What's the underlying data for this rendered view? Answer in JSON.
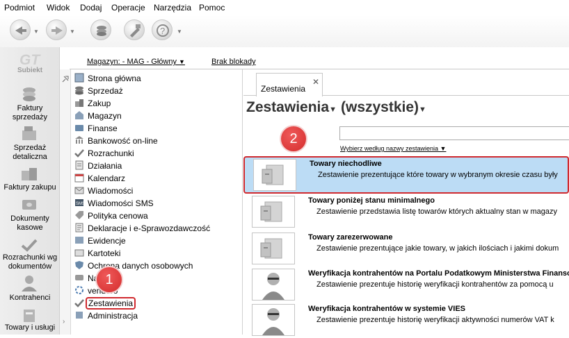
{
  "menu": [
    "Podmiot",
    "Widok",
    "Dodaj",
    "Operacje",
    "Narzędzia",
    "Pomoc"
  ],
  "app_logo": "Subiekt",
  "leftbar": [
    {
      "label": "Faktury sprzedaży",
      "icon": "coins-icon"
    },
    {
      "label": "Sprzedaż detaliczna",
      "icon": "cash-register-icon"
    },
    {
      "label": "Faktury zakupu",
      "icon": "boxes-icon"
    },
    {
      "label": "Dokumenty kasowe",
      "icon": "cash-documents-icon"
    },
    {
      "label": "Rozrachunki wg dokumentów",
      "icon": "settlements-icon"
    },
    {
      "label": "Kontrahenci",
      "icon": "person-icon"
    },
    {
      "label": "Towary i usługi",
      "icon": "goods-icon"
    }
  ],
  "header": {
    "warehouse": "Magazyn: - MAG - Główny",
    "lock_status": "Brak blokady"
  },
  "nav": [
    "Strona główna",
    "Sprzedaż",
    "Zakup",
    "Magazyn",
    "Finanse",
    "Bankowość on-line",
    "Rozrachunki",
    "Działania",
    "Kalendarz",
    "Wiadomości",
    "Wiadomości SMS",
    "Polityka cenowa",
    "Deklaracje i e-Sprawozdawczość",
    "Ewidencje",
    "Kartoteki",
    "Ochrona danych osobowych",
    "Naklejki",
    "vendero",
    "Zestawienia",
    "Administracja"
  ],
  "tab": {
    "label": "Zestawienia",
    "close": "✕"
  },
  "content": {
    "title": "Zestawienia",
    "filter": "(wszystkie)",
    "search_value": "",
    "search_label": "Wybierz według nazwy zestawienia"
  },
  "reports": [
    {
      "title": "Towary niechodliwe",
      "desc": "Zestawienie prezentujące które towary w wybranym okresie czasu były",
      "icon": "goods-report-icon"
    },
    {
      "title": "Towary poniżej stanu minimalnego",
      "desc": "Zestawienie przedstawia listę towarów których aktualny stan w magazy",
      "icon": "goods-report-icon"
    },
    {
      "title": "Towary zarezerwowane",
      "desc": "Zestawienie prezentujące jakie towary, w jakich ilościach i jakimi dokum",
      "icon": "goods-report-icon"
    },
    {
      "title": "Weryfikacja kontrahentów na Portalu Podatkowym Ministerstwa Finanso",
      "desc": "Zestawienie prezentuje historię weryfikacji kontrahentów za pomocą u",
      "icon": "person-report-icon"
    },
    {
      "title": "Weryfikacja kontrahentów w systemie VIES",
      "desc": "Zestawienie prezentuje historię weryfikacji aktywności numerów VAT k",
      "icon": "person-report-icon"
    }
  ],
  "callouts": [
    "1",
    "2"
  ],
  "colors": {
    "highlight_bg": "#bcdcf5",
    "highlight_border": "#d0292e",
    "callout": "#d63030"
  }
}
